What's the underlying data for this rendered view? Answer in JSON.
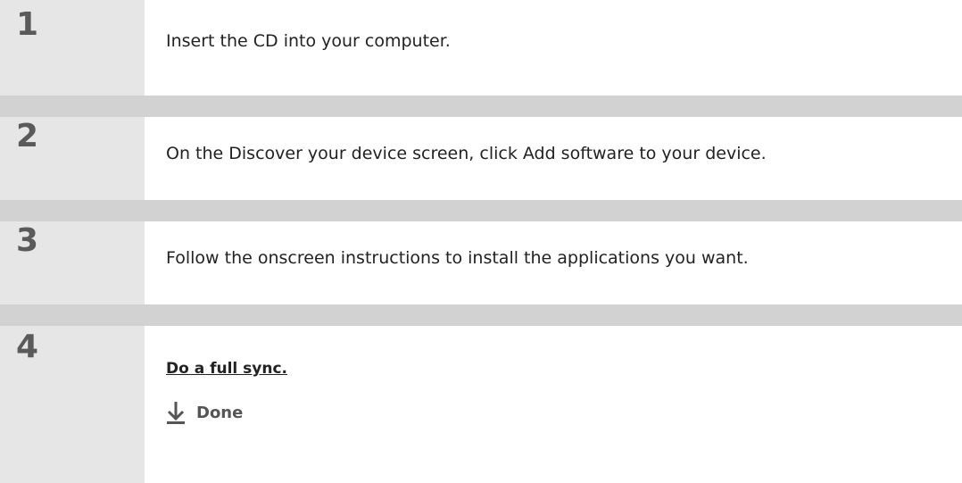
{
  "steps": [
    {
      "number": "1",
      "text": "Insert the CD into your computer."
    },
    {
      "number": "2",
      "text": "On the Discover your device screen, click Add software to your device."
    },
    {
      "number": "3",
      "text": "Follow the onscreen instructions to install the applications you want."
    },
    {
      "number": "4",
      "link_text": "Do a full sync.",
      "done_label": "Done",
      "done_icon": "arrow-down-icon"
    }
  ],
  "colors": {
    "number_panel": "#e6e6e6",
    "separator": "#d2d2d2",
    "number_text": "#5a5a5a",
    "body_text": "#222222"
  }
}
